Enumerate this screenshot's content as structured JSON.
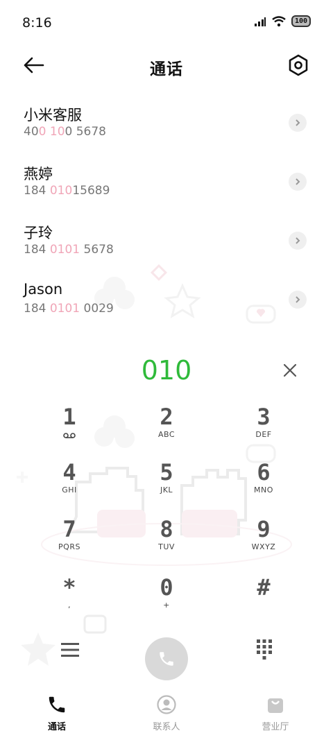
{
  "status_bar": {
    "time": "8:16",
    "battery": "100"
  },
  "header": {
    "title": "通话"
  },
  "contacts": [
    {
      "name": "小米客服",
      "number_parts": [
        "40",
        "0",
        " ",
        "10",
        "0 5678"
      ]
    },
    {
      "name": "燕婷",
      "number_parts": [
        "184 ",
        "010",
        "15689",
        "",
        ""
      ]
    },
    {
      "name": "子玲",
      "number_parts": [
        "184 ",
        "0101",
        " 5678",
        "",
        ""
      ]
    },
    {
      "name": "Jason",
      "number_parts": [
        "184 ",
        "0101",
        " 0029",
        "",
        ""
      ]
    }
  ],
  "dial": {
    "number": "010"
  },
  "keypad": [
    {
      "digit": "1",
      "letters": ""
    },
    {
      "digit": "2",
      "letters": "ABC"
    },
    {
      "digit": "3",
      "letters": "DEF"
    },
    {
      "digit": "4",
      "letters": "GHI"
    },
    {
      "digit": "5",
      "letters": "JKL"
    },
    {
      "digit": "6",
      "letters": "MNO"
    },
    {
      "digit": "7",
      "letters": "PQRS"
    },
    {
      "digit": "8",
      "letters": "TUV"
    },
    {
      "digit": "9",
      "letters": "WXYZ"
    },
    {
      "digit": "*",
      "letters": ","
    },
    {
      "digit": "0",
      "letters": "+"
    },
    {
      "digit": "#",
      "letters": ""
    }
  ],
  "nav": {
    "calls": "通话",
    "contacts": "联系人",
    "store": "营业厅"
  },
  "colors": {
    "accent_green": "#2fba3a",
    "highlight_pink": "#f0a5b7",
    "call_button": "#d9d9d9"
  },
  "icons": {
    "back": "arrow-left-icon",
    "settings": "hexagon-gear-icon",
    "chevron": "chevron-right-icon",
    "clear": "close-icon",
    "voicemail": "voicemail-icon",
    "menu": "menu-icon",
    "call": "phone-icon",
    "dialpad": "dialpad-icon",
    "nav_calls": "phone-icon",
    "nav_contacts": "person-icon",
    "nav_store": "shopping-bag-icon"
  }
}
